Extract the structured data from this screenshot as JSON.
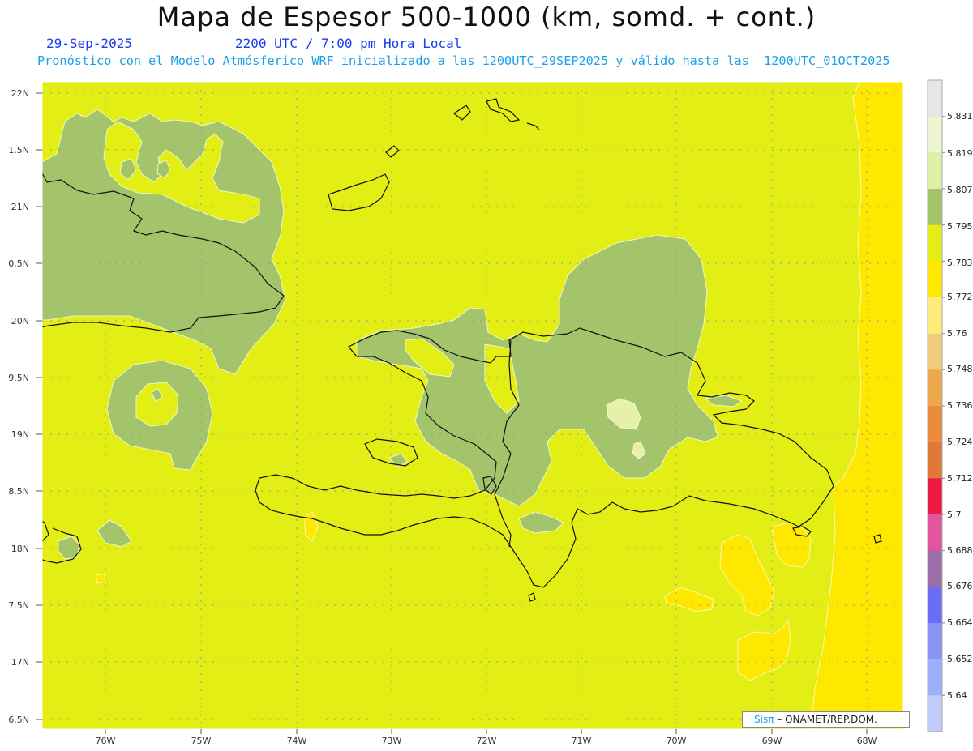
{
  "header": {
    "title": "Mapa de Espesor 500-1000 (km, somd. + cont.)",
    "date": "29-Sep-2025",
    "time": "2200 UTC / 7:00 pm Hora Local",
    "description": "Pronóstico con el Modelo Atmósferico WRF inicializado a las 1200UTC_29SEP2025 y válido hasta las  1200UTC_01OCT2025"
  },
  "axes": {
    "lat_labels": [
      "22N",
      "1.5N",
      "21N",
      "0.5N",
      "20N",
      "9.5N",
      "19N",
      "8.5N",
      "18N",
      "7.5N",
      "17N",
      "6.5N"
    ],
    "lon_labels": [
      "76W",
      "75W",
      "74W",
      "73W",
      "72W",
      "71W",
      "70W",
      "69W",
      "68W"
    ]
  },
  "colorbar": {
    "labels": [
      "5.831",
      "5.819",
      "5.807",
      "5.795",
      "5.783",
      "5.772",
      "5.76",
      "5.748",
      "5.736",
      "5.724",
      "5.712",
      "5.7",
      "5.688",
      "5.676",
      "5.664",
      "5.652",
      "5.64"
    ],
    "colors": [
      "#e6e6e6",
      "#eef5d2",
      "#deefa6",
      "#a3c46a",
      "#e2ee14",
      "#ffe800",
      "#ffec7a",
      "#f2cb7c",
      "#eea84c",
      "#e98c3c",
      "#e0783a",
      "#ee1a46",
      "#e2549e",
      "#9b6ea8",
      "#6c6cf4",
      "#8a94f6",
      "#9cb0fa",
      "#c0ccfc"
    ]
  },
  "legend_colors": {
    "background": "#e2ee14",
    "green": "#a3c46a",
    "pale": "#e7f0a8",
    "yellow": "#ffe800",
    "coast": "#111111",
    "grid": "#9a9a9a"
  },
  "credit": {
    "brand": "Sisπ",
    "text": "– ONAMET/REP.DOM."
  }
}
